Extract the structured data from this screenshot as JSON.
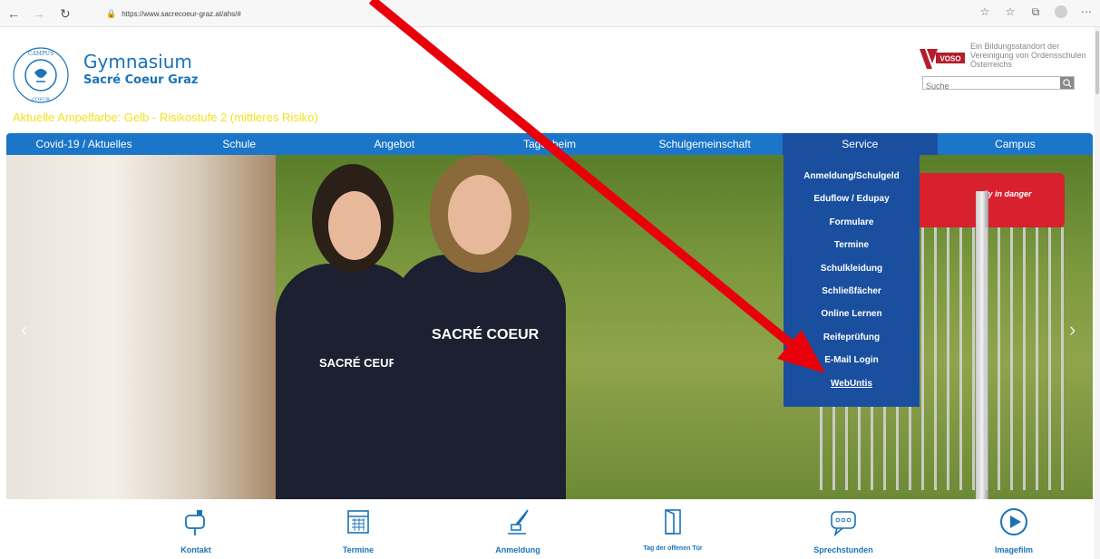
{
  "browser": {
    "url": "https://www.sacrecoeur-graz.at/ahs/#"
  },
  "header": {
    "brand_title": "Gymnasium",
    "brand_subtitle": "Sacré Coeur Graz",
    "voso_logo_text": "VOSO",
    "voso_text": "Ein Bildungsstandort der Vereinigung von Ordensschulen Österreichs",
    "search_placeholder": "Suche",
    "ampel": "Aktuelle Ampelfarbe: Gelb - Risikostufe 2 (mittleres Risiko)"
  },
  "nav": {
    "items": [
      {
        "label": "Covid-19 / Aktuelles"
      },
      {
        "label": "Schule"
      },
      {
        "label": "Angebot"
      },
      {
        "label": "Tagesheim"
      },
      {
        "label": "Schulgemeinschaft"
      },
      {
        "label": "Service"
      },
      {
        "label": "Campus"
      }
    ]
  },
  "dropdown": {
    "items": [
      {
        "label": "Anmeldung/Schulgeld"
      },
      {
        "label": "Eduflow / Edupay"
      },
      {
        "label": "Formulare"
      },
      {
        "label": "Termine"
      },
      {
        "label": "Schulkleidung"
      },
      {
        "label": "Schließfächer"
      },
      {
        "label": "Online Lernen"
      },
      {
        "label": "Reifeprüfung"
      },
      {
        "label": "E-Mail Login"
      },
      {
        "label": "WebUntis"
      }
    ]
  },
  "hero": {
    "shirt_text_1": "SACRÉ COEUR",
    "shirt_text_2": "SACRÉ CEUR",
    "basket_text": "fly in danger"
  },
  "footer": {
    "items": [
      {
        "label": "Kontakt"
      },
      {
        "label": "Termine"
      },
      {
        "label": "Anmeldung"
      },
      {
        "label": "Tag der offenen Tür"
      },
      {
        "label": "Sprechstunden"
      },
      {
        "label": "Imagefilm"
      }
    ]
  },
  "colors": {
    "brand_blue": "#1a73b8",
    "nav_blue": "#1b75c8",
    "dropdown_blue": "#1a4fa0",
    "ampel_yellow": "#f4e21c",
    "arrow_red": "#e8000b"
  }
}
